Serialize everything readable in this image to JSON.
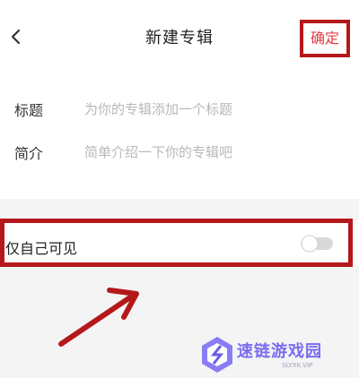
{
  "header": {
    "title": "新建专辑",
    "confirm_label": "确定"
  },
  "form": {
    "title_label": "标题",
    "title_placeholder": "为你的专辑添加一个标题",
    "intro_label": "简介",
    "intro_placeholder": "简单介绍一下你的专辑吧"
  },
  "privacy": {
    "label": "仅自己可见",
    "enabled": false
  },
  "watermark": {
    "name": "速链游戏园",
    "url": "SLYXK.VIP"
  },
  "colors": {
    "accent": "#e33a44",
    "highlight_border": "#b5181b",
    "brand": "#7a6cf0"
  }
}
